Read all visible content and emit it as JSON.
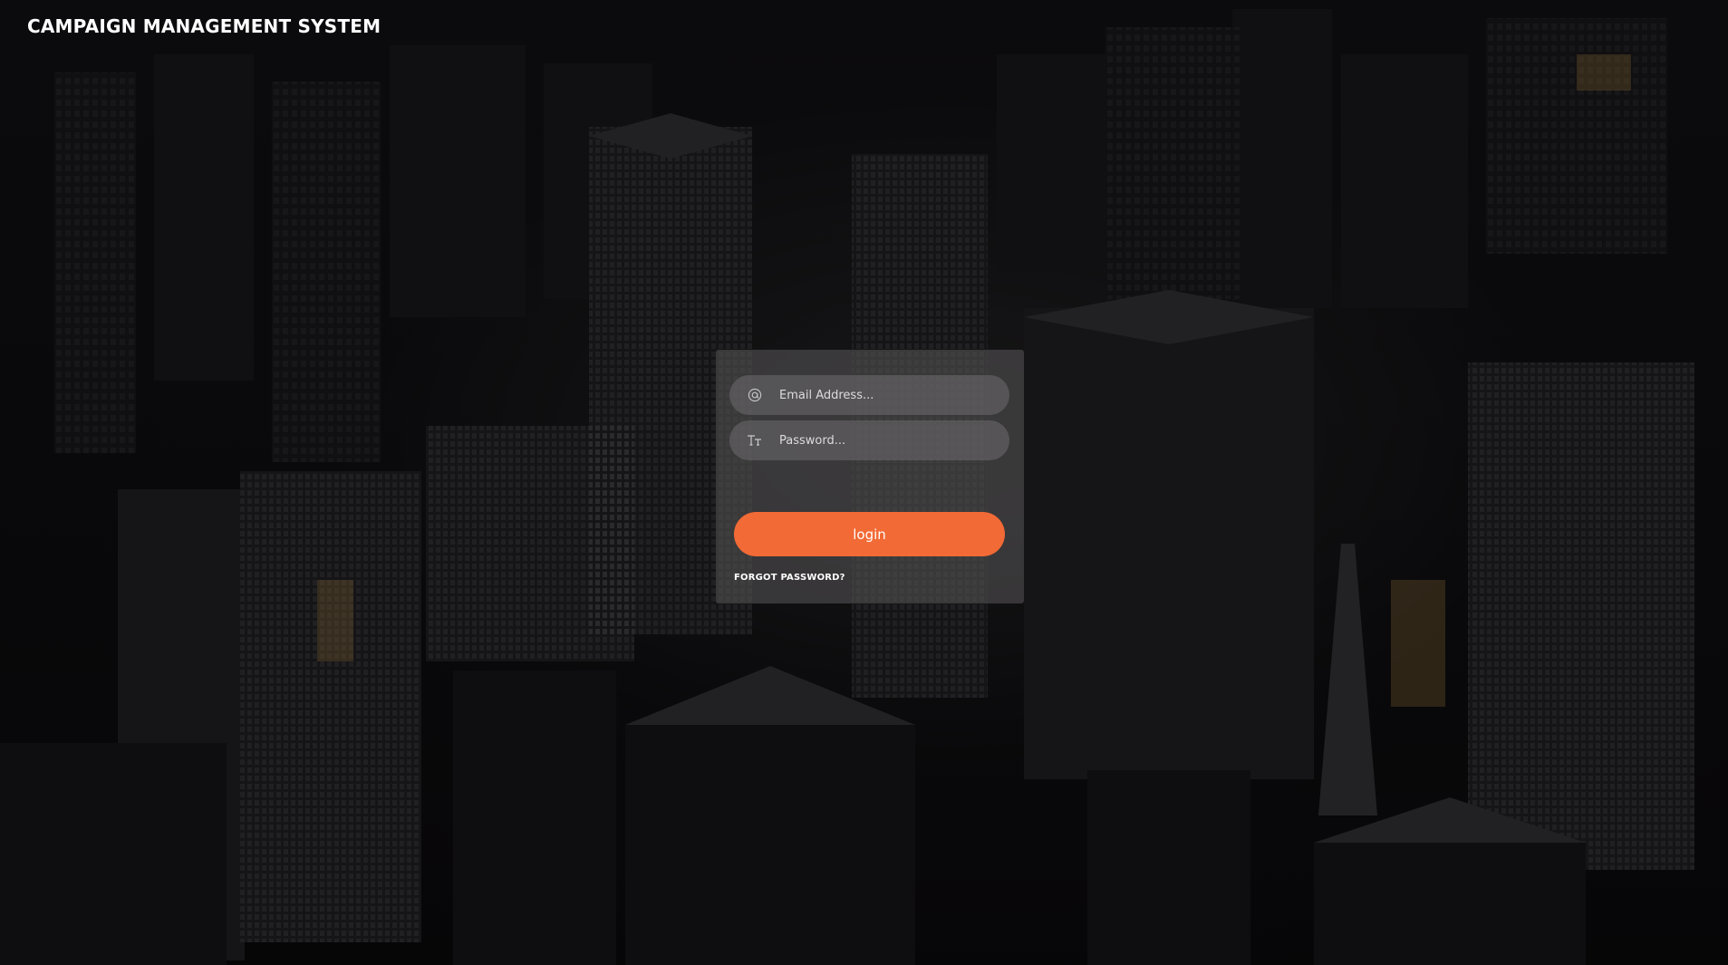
{
  "app": {
    "title": "CAMPAIGN MANAGEMENT SYSTEM"
  },
  "login": {
    "email_placeholder": "Email Address...",
    "email_value": "",
    "email_icon": "at-sign-icon",
    "password_placeholder": "Password...",
    "password_value": "",
    "password_icon": "text-format-icon",
    "submit_label": "login",
    "forgot_label": "FORGOT PASSWORD?"
  },
  "colors": {
    "accent": "#f26a35",
    "background": "#0b0a0b",
    "text": "#ffffff"
  }
}
